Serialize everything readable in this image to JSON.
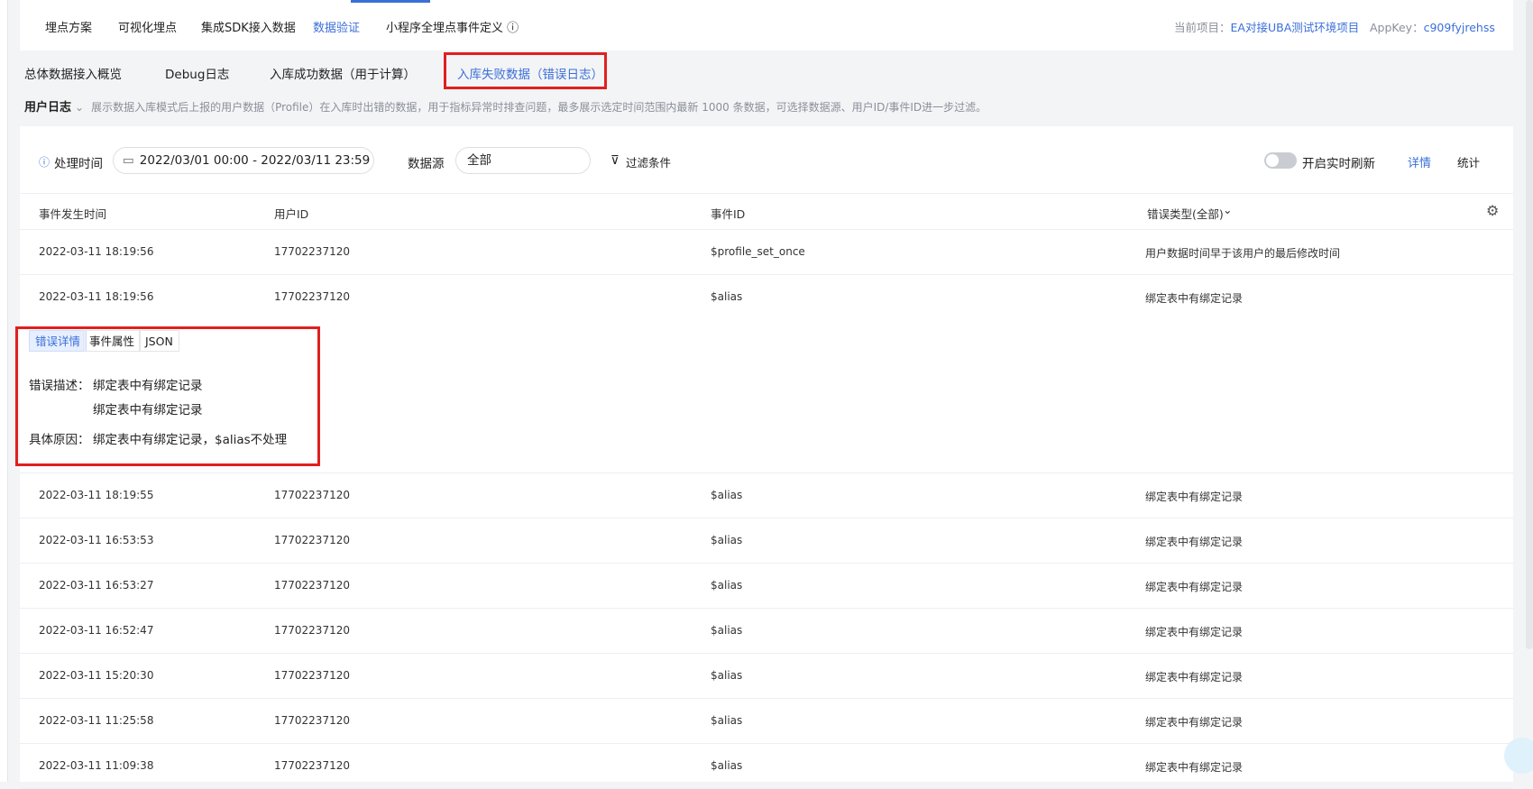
{
  "nav": {
    "items": [
      "埋点方案",
      "可视化埋点",
      "集成SDK接入数据",
      "数据验证",
      "小程序全埋点事件定义 ⓘ"
    ],
    "active": "数据验证",
    "project_label": "当前项目：",
    "project_value": "EA对接UBA测试环境项目",
    "appkey_label": "AppKey：",
    "appkey_value": "c909fyjrehss"
  },
  "subtabs": [
    "总体数据接入概览",
    "Debug日志",
    "入库成功数据（用于计算）",
    "入库失败数据（错误日志）"
  ],
  "description": {
    "title": "用户日志",
    "text": "展示数据入库模式后上报的用户数据（Profile）在入库时出错的数据，用于指标异常时排查问题，最多展示选定时间范围内最新 1000 条数据，可选择数据源、用户ID/事件ID进一步过滤。"
  },
  "filter": {
    "time_label": "处理时间",
    "date_range": "2022/03/01 00:00 - 2022/03/11 23:59",
    "source_label": "数据源",
    "source_value": "全部",
    "conditions_label": "过滤条件",
    "realtime_label": "开启实时刷新",
    "detail_link": "详情",
    "stats_link": "统计"
  },
  "table": {
    "headers": [
      "事件发生时间",
      "用户ID",
      "事件ID",
      "错误类型(全部)"
    ],
    "rows_before": [
      [
        "2022-03-11 18:19:56",
        "17702237120",
        "$profile_set_once",
        "用户数据时间早于该用户的最后修改时间"
      ],
      [
        "2022-03-11 18:19:56",
        "17702237120",
        "$alias",
        "绑定表中有绑定记录"
      ]
    ],
    "rows_after": [
      [
        "2022-03-11 18:19:55",
        "17702237120",
        "$alias",
        "绑定表中有绑定记录"
      ],
      [
        "2022-03-11 16:53:53",
        "17702237120",
        "$alias",
        "绑定表中有绑定记录"
      ],
      [
        "2022-03-11 16:53:27",
        "17702237120",
        "$alias",
        "绑定表中有绑定记录"
      ],
      [
        "2022-03-11 16:52:47",
        "17702237120",
        "$alias",
        "绑定表中有绑定记录"
      ],
      [
        "2022-03-11 15:20:30",
        "17702237120",
        "$alias",
        "绑定表中有绑定记录"
      ],
      [
        "2022-03-11 11:25:58",
        "17702237120",
        "$alias",
        "绑定表中有绑定记录"
      ],
      [
        "2022-03-11 11:09:38",
        "17702237120",
        "$alias",
        "绑定表中有绑定记录"
      ]
    ]
  },
  "expanded": {
    "tabs": [
      "错误详情",
      "事件属性",
      "JSON"
    ],
    "desc_label": "错误描述：",
    "desc_lines": [
      "绑定表中有绑定记录",
      "绑定表中有绑定记录"
    ],
    "reason_label": "具体原因：",
    "reason": "绑定表中有绑定记录，$alias不处理"
  },
  "colors": {
    "accent": "#3b6fd8",
    "highlight": "#e0201f"
  }
}
